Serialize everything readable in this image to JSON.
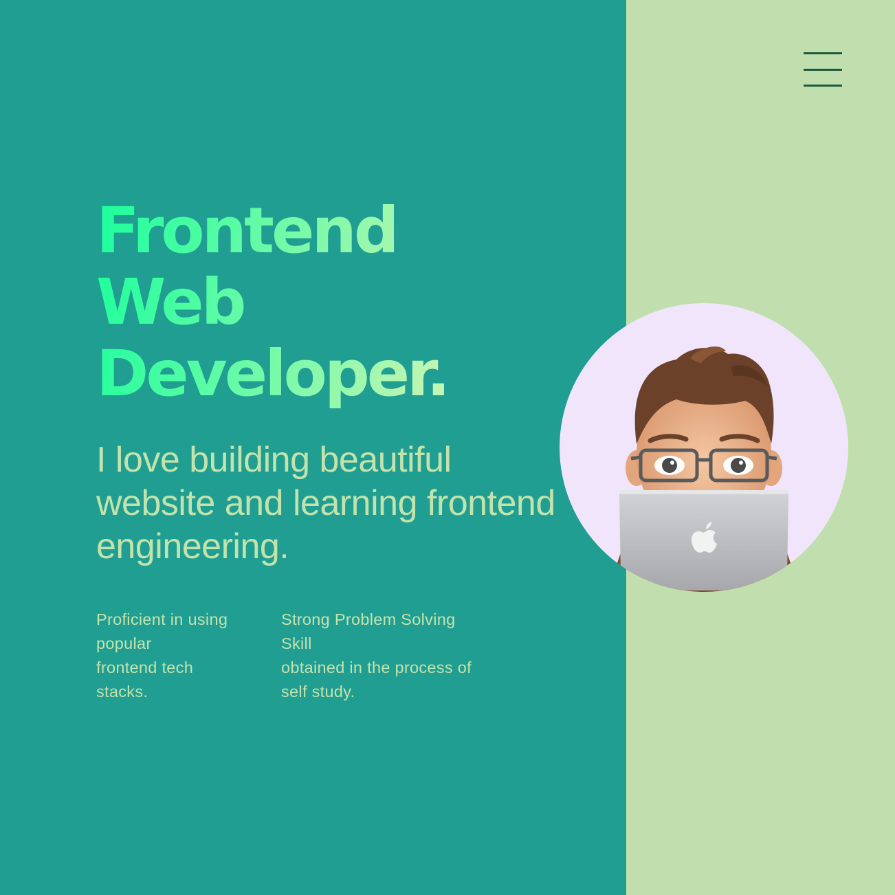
{
  "menu": {
    "icon": "hamburger-menu-icon"
  },
  "hero": {
    "headline": [
      "Frontend",
      "Web",
      "Developer."
    ],
    "tagline": "I love building beautiful website and learning frontend engineering."
  },
  "features": [
    {
      "lines": [
        "Proficient in using",
        "popular",
        "frontend tech",
        "stacks."
      ]
    },
    {
      "lines": [
        "Strong Problem Solving",
        "Skill",
        "obtained in the process of",
        "self study."
      ]
    }
  ],
  "avatar": {
    "icon": "memoji-avatar-with-laptop"
  },
  "colors": {
    "left_background": "#219e92",
    "right_background": "#c1dfae",
    "headline_gradient": [
      "#1aff9c",
      "#c8f5b4"
    ],
    "body_text": "#c3e3ad",
    "menu_lines": "#1f5a3a",
    "avatar_background": "#f0e5fb"
  }
}
